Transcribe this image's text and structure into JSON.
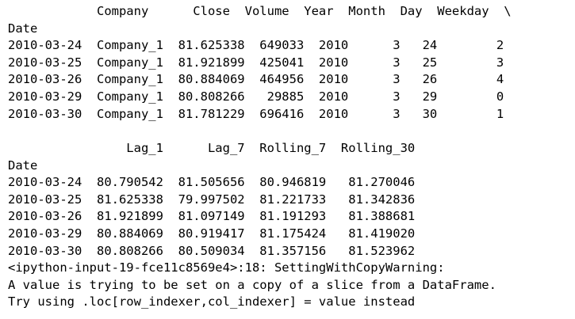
{
  "table1": {
    "header": "            Company      Close  Volume  Year  Month  Day  Weekday  \\",
    "index_label": "Date",
    "rows": [
      "2010-03-24  Company_1  81.625338  649033  2010      3   24        2",
      "2010-03-25  Company_1  81.921899  425041  2010      3   25        3",
      "2010-03-26  Company_1  80.884069  464956  2010      3   26        4",
      "2010-03-29  Company_1  80.808266   29885  2010      3   29        0",
      "2010-03-30  Company_1  81.781229  696416  2010      3   30        1"
    ]
  },
  "table2": {
    "header": "                Lag_1      Lag_7  Rolling_7  Rolling_30",
    "index_label": "Date",
    "rows": [
      "2010-03-24  80.790542  81.505656  80.946819   81.270046",
      "2010-03-25  81.625338  79.997502  81.221733   81.342836",
      "2010-03-26  81.921899  81.097149  81.191293   81.388681",
      "2010-03-29  80.884069  80.919417  81.175424   81.419020",
      "2010-03-30  80.808266  80.509034  81.357156   81.523962"
    ]
  },
  "warning": {
    "line1": "<ipython-input-19-fce11c8569e4>:18: SettingWithCopyWarning:",
    "line2": "A value is trying to be set on a copy of a slice from a DataFrame.",
    "line3": "Try using .loc[row_indexer,col_indexer] = value instead"
  }
}
